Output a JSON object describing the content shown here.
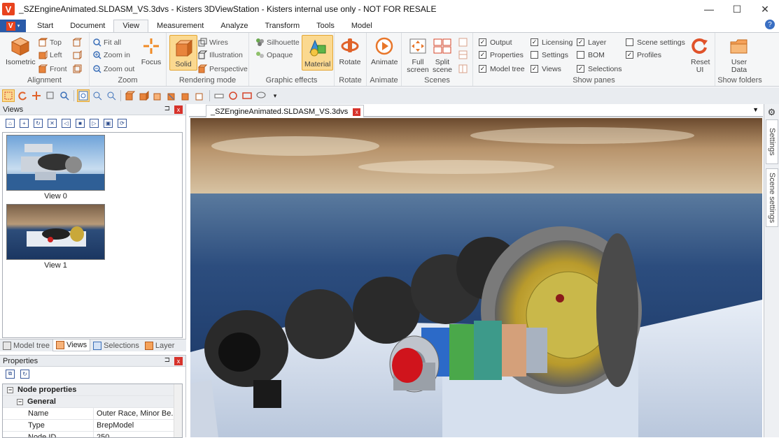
{
  "window": {
    "logo_letter": "V",
    "title": "_SZEngineAnimated.SLDASM_VS.3dvs - Kisters 3DViewStation - Kisters internal use only - NOT FOR RESALE",
    "minimize": "—",
    "maximize": "☐",
    "close": "✕"
  },
  "ribbon_tabs": {
    "app_menu_letter": "V",
    "tabs": [
      "Start",
      "Document",
      "View",
      "Measurement",
      "Analyze",
      "Transform",
      "Tools",
      "Model"
    ],
    "active": "View",
    "help": "?"
  },
  "ribbon": {
    "alignment": {
      "label": "Alignment",
      "isometric": "Isometric",
      "top": "Top",
      "left": "Left",
      "front": "Front"
    },
    "zoom": {
      "label": "Zoom",
      "fit_all": "Fit all",
      "zoom_in": "Zoom in",
      "zoom_out": "Zoom out",
      "focus": "Focus"
    },
    "rendering_mode": {
      "label": "Rendering mode",
      "solid": "Solid",
      "wires": "Wires",
      "illustration": "Illustration",
      "perspective": "Perspective"
    },
    "graphic_effects": {
      "label": "Graphic effects",
      "silhouette": "Silhouette",
      "opaque": "Opaque",
      "material": "Material"
    },
    "rotate": {
      "label": "Rotate",
      "button": "Rotate"
    },
    "animate": {
      "label": "Animate",
      "button": "Animate"
    },
    "scenes": {
      "label": "Scenes",
      "full_screen": "Full screen",
      "split_scene": "Split scene"
    },
    "show_panes": {
      "label": "Show panes",
      "items": [
        {
          "label": "Output",
          "checked": true
        },
        {
          "label": "Properties",
          "checked": true
        },
        {
          "label": "Model tree",
          "checked": true
        },
        {
          "label": "Licensing",
          "checked": true
        },
        {
          "label": "Settings",
          "checked": false
        },
        {
          "label": "Views",
          "checked": true
        },
        {
          "label": "Layer",
          "checked": true
        },
        {
          "label": "BOM",
          "checked": false
        },
        {
          "label": "Selections",
          "checked": true
        },
        {
          "label": "Scene settings",
          "checked": false
        },
        {
          "label": "Profiles",
          "checked": true
        }
      ],
      "reset_ui": "Reset UI"
    },
    "show_folders": {
      "label": "Show folders",
      "user_data": "User Data"
    }
  },
  "views_panel": {
    "title": "Views",
    "pin": "⊐",
    "close": "x",
    "views": [
      {
        "label": "View 0"
      },
      {
        "label": "View 1"
      }
    ],
    "tabs": [
      "Model tree",
      "Views",
      "Selections",
      "Layer"
    ],
    "active_tab": "Views"
  },
  "properties_panel": {
    "title": "Properties",
    "pin": "⊐",
    "close": "x",
    "section": "Node properties",
    "subsection": "General",
    "rows": [
      {
        "key": "Name",
        "value": "Outer Race, Minor Be..."
      },
      {
        "key": "Type",
        "value": "BrepModel"
      },
      {
        "key": "Node ID",
        "value": "250"
      }
    ]
  },
  "document": {
    "tab_title": "_SZEngineAnimated.SLDASM_VS.3dvs",
    "tab_close": "x",
    "menu": "▼"
  },
  "right_dock": {
    "tabs": [
      "Settings",
      "Scene settings"
    ]
  },
  "colors": {
    "accent_blue": "#2a5aa8",
    "logo_red": "#e8431e",
    "selection_orange": "#fbd990",
    "close_red": "#d7332b"
  }
}
